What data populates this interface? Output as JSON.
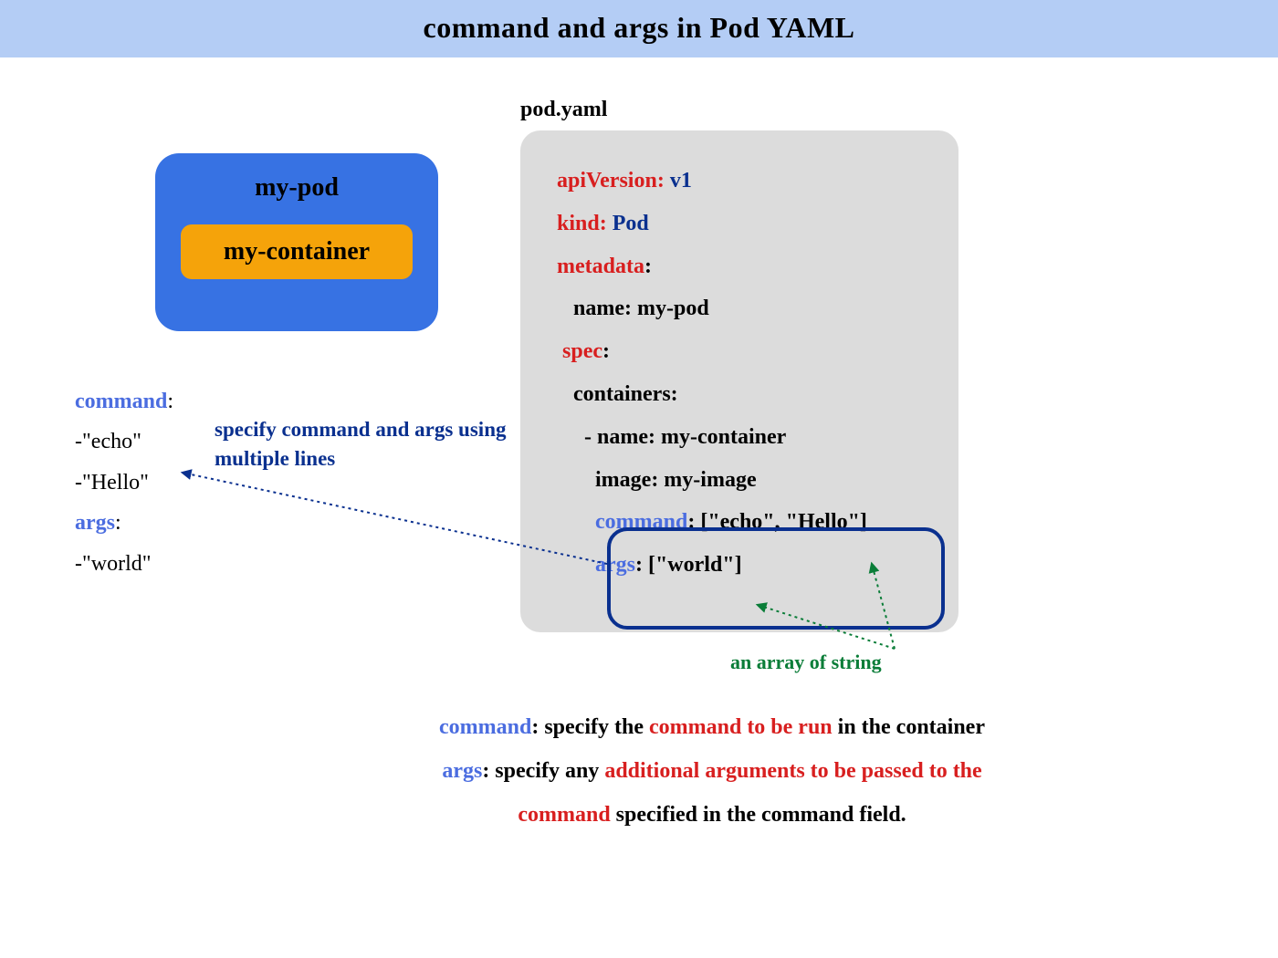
{
  "header": {
    "title": "command and args in Pod YAML"
  },
  "pod": {
    "name": "my-pod",
    "container_name": "my-container"
  },
  "multiline": {
    "command_key": "command",
    "command_items": [
      "-\"echo\"",
      "-\"Hello\""
    ],
    "args_key": "args",
    "args_items": [
      "-\"world\""
    ]
  },
  "hint_multiline": "specify command and args using multiple lines",
  "yaml": {
    "filename": "pod.yaml",
    "lines": [
      {
        "k": "apiVersion",
        "v": "v1"
      },
      {
        "k": "kind",
        "v": "Pod"
      },
      {
        "k": "metadata",
        "colon": ":"
      },
      {
        "plain": "   name: my-pod"
      },
      {
        "k": "spec",
        "colon": ":",
        "indent": " "
      },
      {
        "plain": "   containers:"
      },
      {
        "plain": "     - name: my-container"
      },
      {
        "plain": "       image: my-image"
      },
      {
        "cmd_key": "command",
        "cmd_val": ": [\"echo\", \"Hello\"]",
        "indent": "       "
      },
      {
        "cmd_key": "args",
        "cmd_val": ": [\"world\"]",
        "indent": "       "
      }
    ]
  },
  "hint_array": "an array of string",
  "desc": {
    "d1_1": "command",
    "d1_2": ": specify the ",
    "d1_3": "command to be run",
    "d1_4": " in the container",
    "d2_1": "args",
    "d2_2": ": specify any ",
    "d2_3": "additional arguments to be passed to the",
    "d3_1": "command",
    "d3_2": " specified in the command field."
  }
}
